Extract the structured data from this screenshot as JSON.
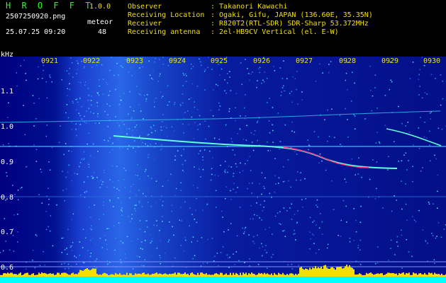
{
  "app": {
    "name": "H R O F F T",
    "version": "1.0.0"
  },
  "file": {
    "name": "2507250920.png",
    "datetime": "25.07.25 09:20"
  },
  "meteor": {
    "label": "meteor",
    "count": "48"
  },
  "info": [
    {
      "label": "Observer",
      "value": ": Takanori Kawachi"
    },
    {
      "label": "Receiving Location",
      "value": ": Ogaki, Gifu, JAPAN (136.60E, 35.35N)"
    },
    {
      "label": "Receiver",
      "value": ": R820T2(RTL-SDR) SDR-Sharp 53.372MHz"
    },
    {
      "label": "Receiving antenna",
      "value": ": 2el-HB9CV Vertical (el. E-W)"
    }
  ],
  "axis": {
    "y_unit": "kHz",
    "y_ticks": [
      "1.1",
      "1.0",
      "0.9",
      "0.8",
      "0.7",
      "0.6"
    ],
    "x_ticks": [
      "0921",
      "0922",
      "0923",
      "0924",
      "0925",
      "0926",
      "0927",
      "0928",
      "0929",
      "0930"
    ]
  },
  "colors": {
    "background": "#00008c",
    "header_text": "#22ff22",
    "tick_text": "#f0e000",
    "baseline": "#00ffff"
  }
}
